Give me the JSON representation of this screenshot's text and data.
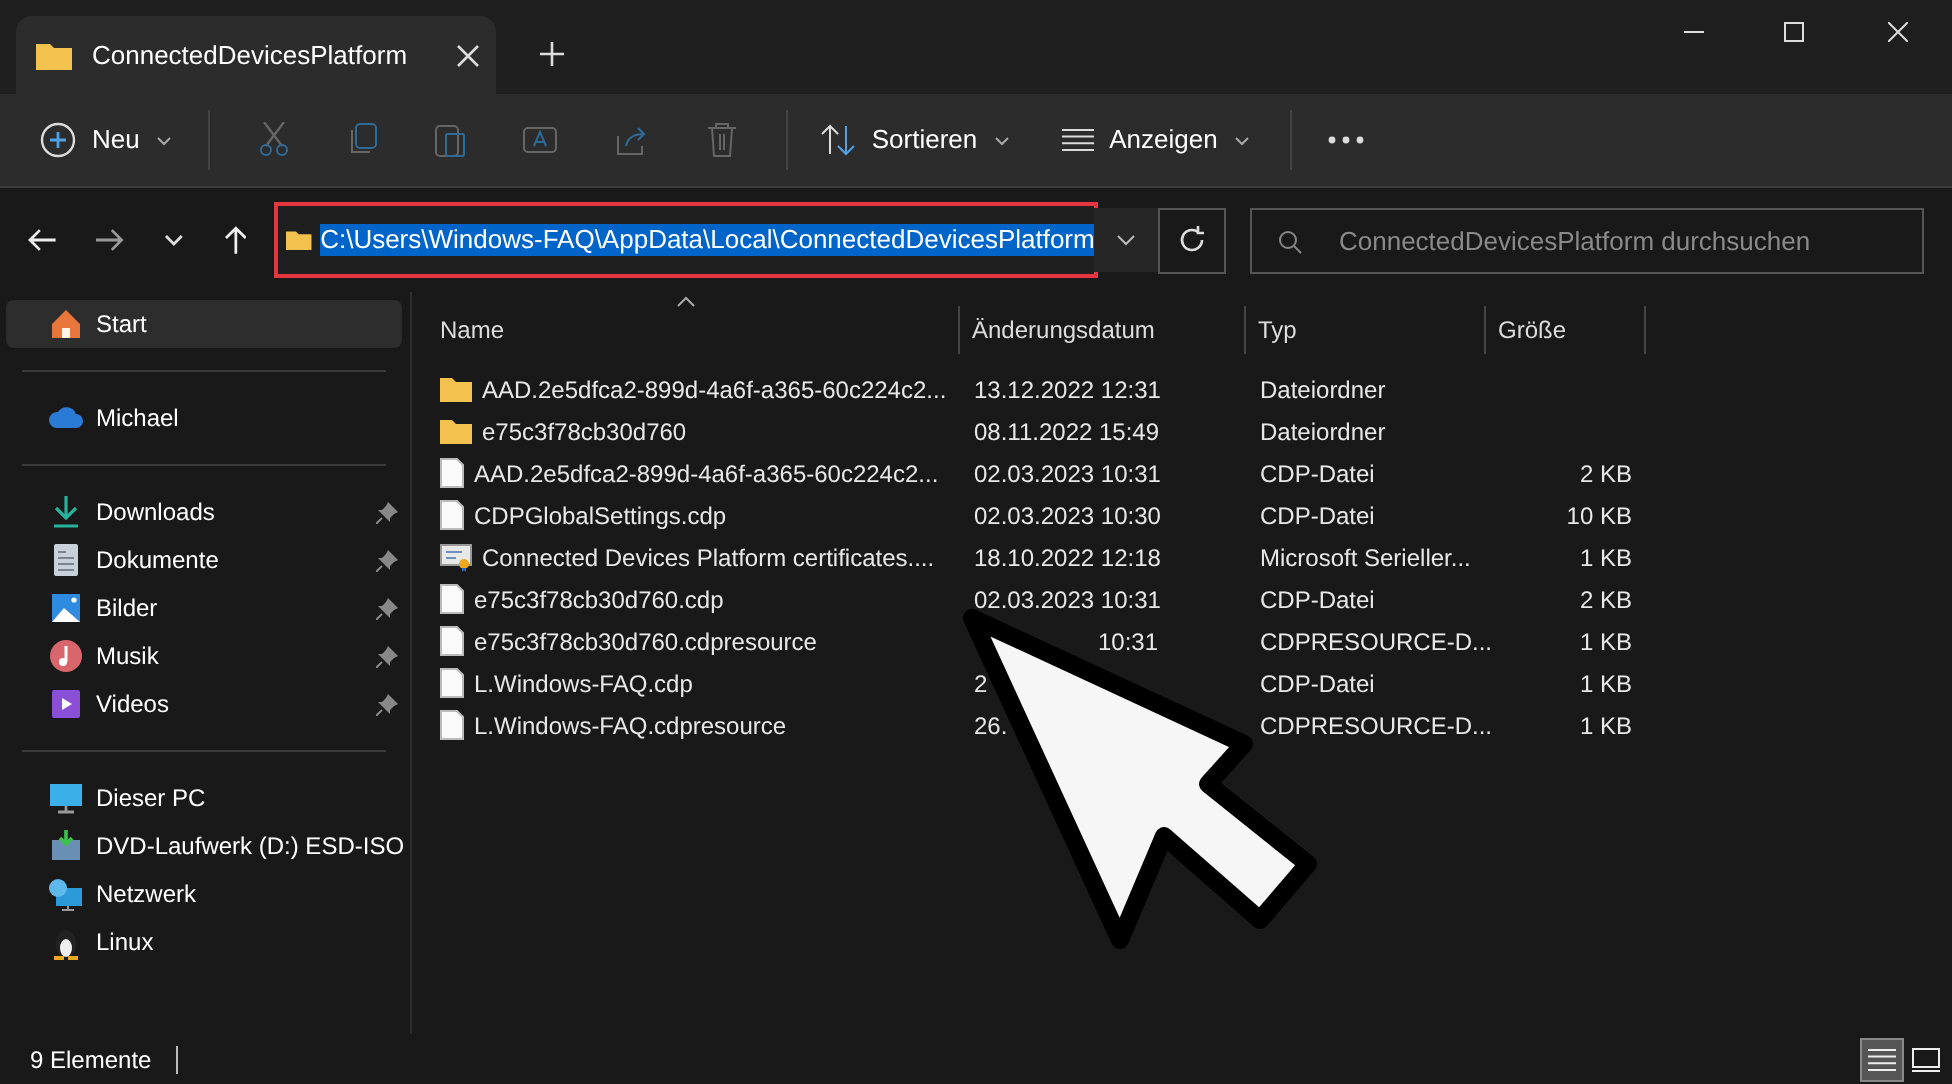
{
  "tab": {
    "title": "ConnectedDevicesPlatform",
    "selected": true
  },
  "toolbar": {
    "new_label": "Neu",
    "sort_label": "Sortieren",
    "view_label": "Anzeigen"
  },
  "address": {
    "path": "C:\\Users\\Windows-FAQ\\AppData\\Local\\ConnectedDevicesPlatform",
    "highlighted": true
  },
  "search": {
    "placeholder": "ConnectedDevicesPlatform durchsuchen"
  },
  "sidebar": {
    "items": [
      {
        "label": "Start",
        "kind": "home",
        "selected": true,
        "pinned": false,
        "group_end": true
      },
      {
        "label": "Michael",
        "kind": "cloud",
        "selected": false,
        "pinned": false,
        "group_end": true
      },
      {
        "label": "Downloads",
        "kind": "download",
        "selected": false,
        "pinned": true,
        "group_end": false
      },
      {
        "label": "Dokumente",
        "kind": "document",
        "selected": false,
        "pinned": true,
        "group_end": false
      },
      {
        "label": "Bilder",
        "kind": "pictures",
        "selected": false,
        "pinned": true,
        "group_end": false
      },
      {
        "label": "Musik",
        "kind": "music",
        "selected": false,
        "pinned": true,
        "group_end": false
      },
      {
        "label": "Videos",
        "kind": "video",
        "selected": false,
        "pinned": true,
        "group_end": true
      },
      {
        "label": "Dieser PC",
        "kind": "pc",
        "selected": false,
        "pinned": false,
        "group_end": false
      },
      {
        "label": "DVD-Laufwerk (D:) ESD-ISO",
        "kind": "dvd",
        "selected": false,
        "pinned": false,
        "group_end": false
      },
      {
        "label": "Netzwerk",
        "kind": "network",
        "selected": false,
        "pinned": false,
        "group_end": false
      },
      {
        "label": "Linux",
        "kind": "linux",
        "selected": false,
        "pinned": false,
        "group_end": false
      }
    ]
  },
  "table": {
    "columns": [
      "Name",
      "Änderungsdatum",
      "Typ",
      "Größe"
    ],
    "rows": [
      {
        "kind": "folder",
        "name": "AAD.2e5dfca2-899d-4a6f-a365-60c224c2...",
        "date": "13.12.2022 12:31",
        "type": "Dateiordner",
        "date_cut_start": false
      },
      {
        "kind": "folder",
        "name": "e75c3f78cb30d760",
        "date": "08.11.2022 15:49",
        "type": "Dateiordner",
        "date_cut_start": false
      },
      {
        "kind": "file",
        "name": "AAD.2e5dfca2-899d-4a6f-a365-60c224c2...",
        "date": "02.03.2023 10:31",
        "type": "CDP-Datei",
        "size": "2 KB",
        "date_cut_start": false
      },
      {
        "kind": "file",
        "name": "CDPGlobalSettings.cdp",
        "date": "02.03.2023 10:30",
        "type": "CDP-Datei",
        "size": "10 KB",
        "date_cut_start": false
      },
      {
        "kind": "certificate",
        "name": "Connected Devices Platform certificates....",
        "date": "18.10.2022 12:18",
        "type": "Microsoft Serieller...",
        "size": "1 KB",
        "date_cut_start": false
      },
      {
        "kind": "file",
        "name": "e75c3f78cb30d760.cdp",
        "date": "02.03.2023 10:31",
        "type": "CDP-Datei",
        "size": "2 KB",
        "date_cut_start": false
      },
      {
        "kind": "file",
        "name": "e75c3f78cb30d760.cdpresource",
        "date": "10:31",
        "type": "CDPRESOURCE-D...",
        "size": "1 KB",
        "date_cut_start": true
      },
      {
        "kind": "file",
        "name": "L.Windows-FAQ.cdp",
        "date": "2",
        "type": "CDP-Datei",
        "size": "1 KB",
        "date_cut_start": false
      },
      {
        "kind": "file",
        "name": "L.Windows-FAQ.cdpresource",
        "date": "26.",
        "type": "CDPRESOURCE-D...",
        "size": "1 KB",
        "date_cut_start": false
      }
    ]
  },
  "status_bar": {
    "count": "9 Elemente",
    "details_view": true
  }
}
